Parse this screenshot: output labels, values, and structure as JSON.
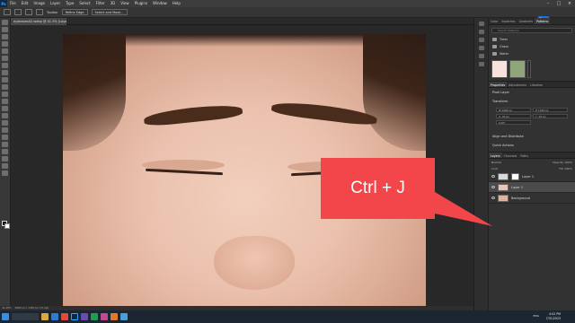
{
  "menubar": {
    "logo": "Ps",
    "items": [
      "File",
      "Edit",
      "Image",
      "Layer",
      "Type",
      "Select",
      "Filter",
      "3D",
      "View",
      "Plugins",
      "Window",
      "Help"
    ]
  },
  "options_bar": {
    "tolerance_label": "Toolbar",
    "subject_button": "Refine Edge",
    "select_mask_button": "Select and Mask...",
    "share_button": "Share"
  },
  "document": {
    "tab_title": "eyebrows02.webp @ 41.3% (Layer 1, RGB/8#) *"
  },
  "callout": {
    "text": "Ctrl + J",
    "color": "#f2464a"
  },
  "panels": {
    "top_tabs": [
      "Color",
      "Swatches",
      "Gradients",
      "Patterns"
    ],
    "active_top_tab": "Patterns",
    "search_placeholder": "Search Patterns",
    "folders": [
      "Trees",
      "Grass",
      "Water"
    ],
    "properties_tabs": [
      "Properties",
      "Adjustments",
      "Libraries"
    ],
    "properties_type": "Pixel Layer",
    "transform_title": "Transform",
    "transform_fields": [
      "W 1080 px",
      "H 1349 px",
      "X -43 px",
      "Y -32 px",
      "0.00°",
      ""
    ],
    "align_title": "Align and Distribute",
    "quick_actions": "Quick Actions",
    "layers_tabs": [
      "Layers",
      "Channels",
      "Paths"
    ],
    "blend_mode": "Normal",
    "opacity": "Opacity: 100%",
    "lock": "Lock:",
    "fill": "Fill: 100%",
    "layers": [
      {
        "name": "Layer 1",
        "selected": false,
        "has_mask": true
      },
      {
        "name": "Layer 1",
        "selected": true,
        "has_mask": false
      },
      {
        "name": "Background",
        "selected": false,
        "has_mask": false
      }
    ]
  },
  "status_bar": {
    "zoom": "41.28%",
    "doc_size": "1080 px x 1350 px (72 ppi)"
  },
  "taskbar": {
    "time": "4:02 PM",
    "date": "7/31/2023",
    "tray": "ENG"
  },
  "icons": [
    "photoshop-logo-icon",
    "minimize-icon",
    "maximize-icon",
    "close-icon",
    "move-tool-icon",
    "folder-icon",
    "eye-icon",
    "windows-start-icon",
    "search-icon"
  ]
}
